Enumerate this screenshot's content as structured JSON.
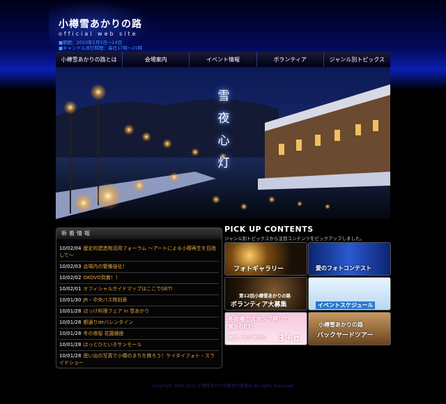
{
  "header": {
    "title": "小樽雪あかりの路",
    "subtitle": "official web site",
    "period": "■期間：2010年2月5日〜14日",
    "lighting": "■キャンドル点灯時間：毎日17時〜21時"
  },
  "nav": {
    "items": [
      {
        "label": "小樽雪あかりの路とは"
      },
      {
        "label": "会場案内"
      },
      {
        "label": "イベント情報"
      },
      {
        "label": "ボランティア"
      },
      {
        "label": "ジャンル別トピックス"
      }
    ]
  },
  "hero": {
    "caption": "雪夜心灯"
  },
  "news": {
    "title": "新着情報",
    "items": [
      {
        "date": "10/02/04",
        "text": "歴史的建造物活用フォーラム 〜アートによる小樽再生を目指して〜"
      },
      {
        "date": "10/02/03",
        "text": "会場内の警備強化！"
      },
      {
        "date": "10/02/02",
        "text": "OKOVO到着！！"
      },
      {
        "date": "10/02/01",
        "text": "オフィシャルガイドマップはここでGET!"
      },
      {
        "date": "10/01/30",
        "text": "JR・中央バス時刻表"
      },
      {
        "date": "10/01/28",
        "text": "ほっけ料理フェア in 雪あかり"
      },
      {
        "date": "10/01/28",
        "text": "都通りdeバレンタイン"
      },
      {
        "date": "10/01/28",
        "text": "冬の夜桜 花園銀座"
      },
      {
        "date": "10/01/28",
        "text": "ほっとひといきサンモール"
      },
      {
        "date": "10/01/28",
        "text": "思い出の写真で小樽のまちを飾ろう！ケイタイフォト・スライドショー"
      }
    ]
  },
  "pickup": {
    "title": "PICK UP CONTENTS",
    "subtitle": "ジャンル別トピックスから注目コンテンツをピックアップしました。",
    "banners": [
      {
        "label": "フォトギャラリー"
      },
      {
        "label": "愛のフォトコンテスト"
      },
      {
        "label_line1": "第12回小樽雪あかりの路",
        "label_line2": "ボランティア大募集"
      },
      {
        "label": "イベントスケジュール"
      },
      {
        "label_line1": "各会場でスタンプ押して",
        "label_line2": "賞品GET!",
        "label_line3": "地上ノホシサガシ",
        "label_line4": "3＋α"
      },
      {
        "label_line1": "小樽雪あかりの路",
        "label_line2": "バックヤードツアー"
      }
    ]
  },
  "footer": {
    "copyright": "Copyright 2000-2010 小樽雪あかりの路実行委員会 All rights Reserved."
  }
}
